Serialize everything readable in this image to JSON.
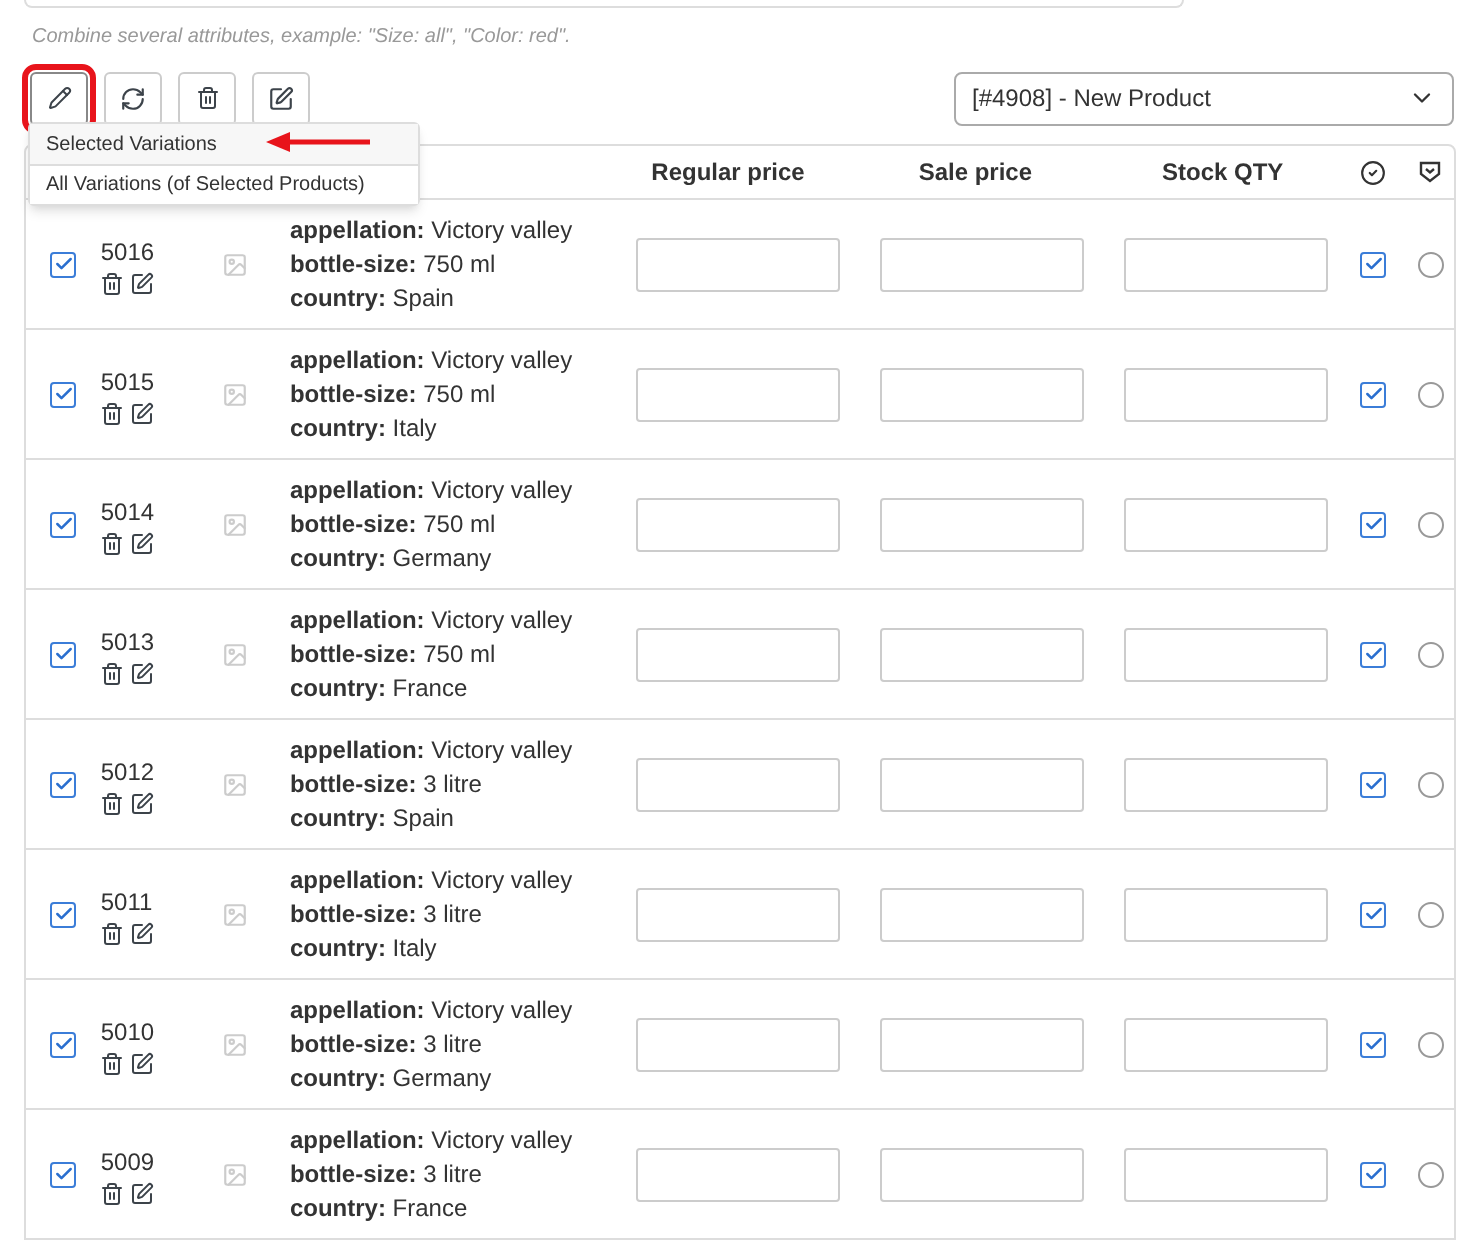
{
  "hint": "Combine several attributes, example: \"Size: all\", \"Color: red\".",
  "toolbar": [
    {
      "kind": "pencil",
      "selected": true
    },
    {
      "kind": "refresh",
      "selected": false
    },
    {
      "kind": "trash",
      "selected": false
    },
    {
      "kind": "edit",
      "selected": false
    }
  ],
  "product_select": {
    "value": "[#4908] - New Product"
  },
  "menu": [
    {
      "label": "Selected Variations",
      "selected": true
    },
    {
      "label": "All Variations (of Selected Products)",
      "selected": false
    }
  ],
  "table": {
    "columns": [
      "Regular price",
      "Sale price",
      "Stock QTY"
    ],
    "rows": [
      {
        "checked": true,
        "id": "5016",
        "attributes": [
          "**appellation:** Victory valley",
          "**bottle-size:** 750 ml",
          "**country:** Spain"
        ],
        "enabled": true,
        "default": false
      },
      {
        "checked": true,
        "id": "5015",
        "attributes": [
          "**appellation:** Victory valley",
          "**bottle-size:** 750 ml",
          "**country:** Italy"
        ],
        "enabled": true,
        "default": false
      },
      {
        "checked": true,
        "id": "5014",
        "attributes": [
          "**appellation:** Victory valley",
          "**bottle-size:** 750 ml",
          "**country:** Germany"
        ],
        "enabled": true,
        "default": false
      },
      {
        "checked": true,
        "id": "5013",
        "attributes": [
          "**appellation:** Victory valley",
          "**bottle-size:** 750 ml",
          "**country:** France"
        ],
        "enabled": true,
        "default": false
      },
      {
        "checked": true,
        "id": "5012",
        "attributes": [
          "**appellation:** Victory valley",
          "**bottle-size:** 3 litre",
          "**country:** Spain"
        ],
        "enabled": true,
        "default": false
      },
      {
        "checked": true,
        "id": "5011",
        "attributes": [
          "**appellation:** Victory valley",
          "**bottle-size:** 3 litre",
          "**country:** Italy"
        ],
        "enabled": true,
        "default": false
      },
      {
        "checked": true,
        "id": "5010",
        "attributes": [
          "**appellation:** Victory valley",
          "**bottle-size:** 3 litre",
          "**country:** Germany"
        ],
        "enabled": true,
        "default": false
      },
      {
        "checked": true,
        "id": "5009",
        "attributes": [
          "**appellation:** Victory valley",
          "**bottle-size:** 3 litre",
          "**country:** France"
        ],
        "enabled": true,
        "default": false
      }
    ]
  }
}
